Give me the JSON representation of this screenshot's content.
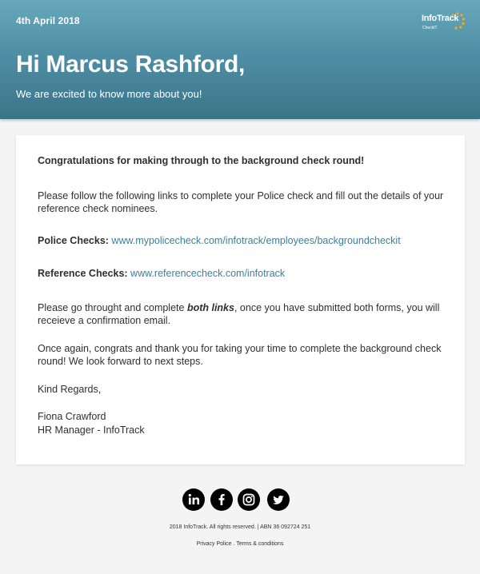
{
  "header": {
    "date": "4th April 2018",
    "logo_text": "InfoTrack",
    "logo_sub": "CheckIT",
    "greeting": "Hi Marcus Rashford,",
    "subtitle": "We are excited to know more about you!"
  },
  "body": {
    "congrats": "Congratulations for making through to the background check round!",
    "instructions": "Please follow the following links to complete your Police check and fill out the details of your reference check nominees.",
    "police_label": "Police Checks:",
    "police_link": " www.mypolicecheck.com/infotrack/employees/backgroundcheckit",
    "reference_label": "Reference Checks:",
    "reference_link": "www.referencecheck.com/infotrack",
    "complete_pre": "Please go throught and complete ",
    "complete_bold": "both links",
    "complete_post": ", once you have submitted both forms, you will receieve a confirmation email.",
    "again": "Once again, congrats and thank you for taking your time to complete the background check round! We look forward to next steps.",
    "regards": "Kind Regards,",
    "signer_name": "Fiona Crawford",
    "signer_title": "HR Manager - InfoTrack"
  },
  "footer": {
    "social_icons": [
      "linkedin-icon",
      "facebook-icon",
      "instagram-icon",
      "twitter-icon"
    ],
    "copyright": "2018 InfoTrack. All rights reserved. | ABN 36 092724 251",
    "privacy_label": "Privacy Police",
    "separator": " . ",
    "terms_label": "Terms & conditions"
  },
  "colors": {
    "header_top": "#68a8bc",
    "header_bottom": "#3a7489",
    "link": "#3f7f97",
    "logo_dots": "#f5a623"
  }
}
